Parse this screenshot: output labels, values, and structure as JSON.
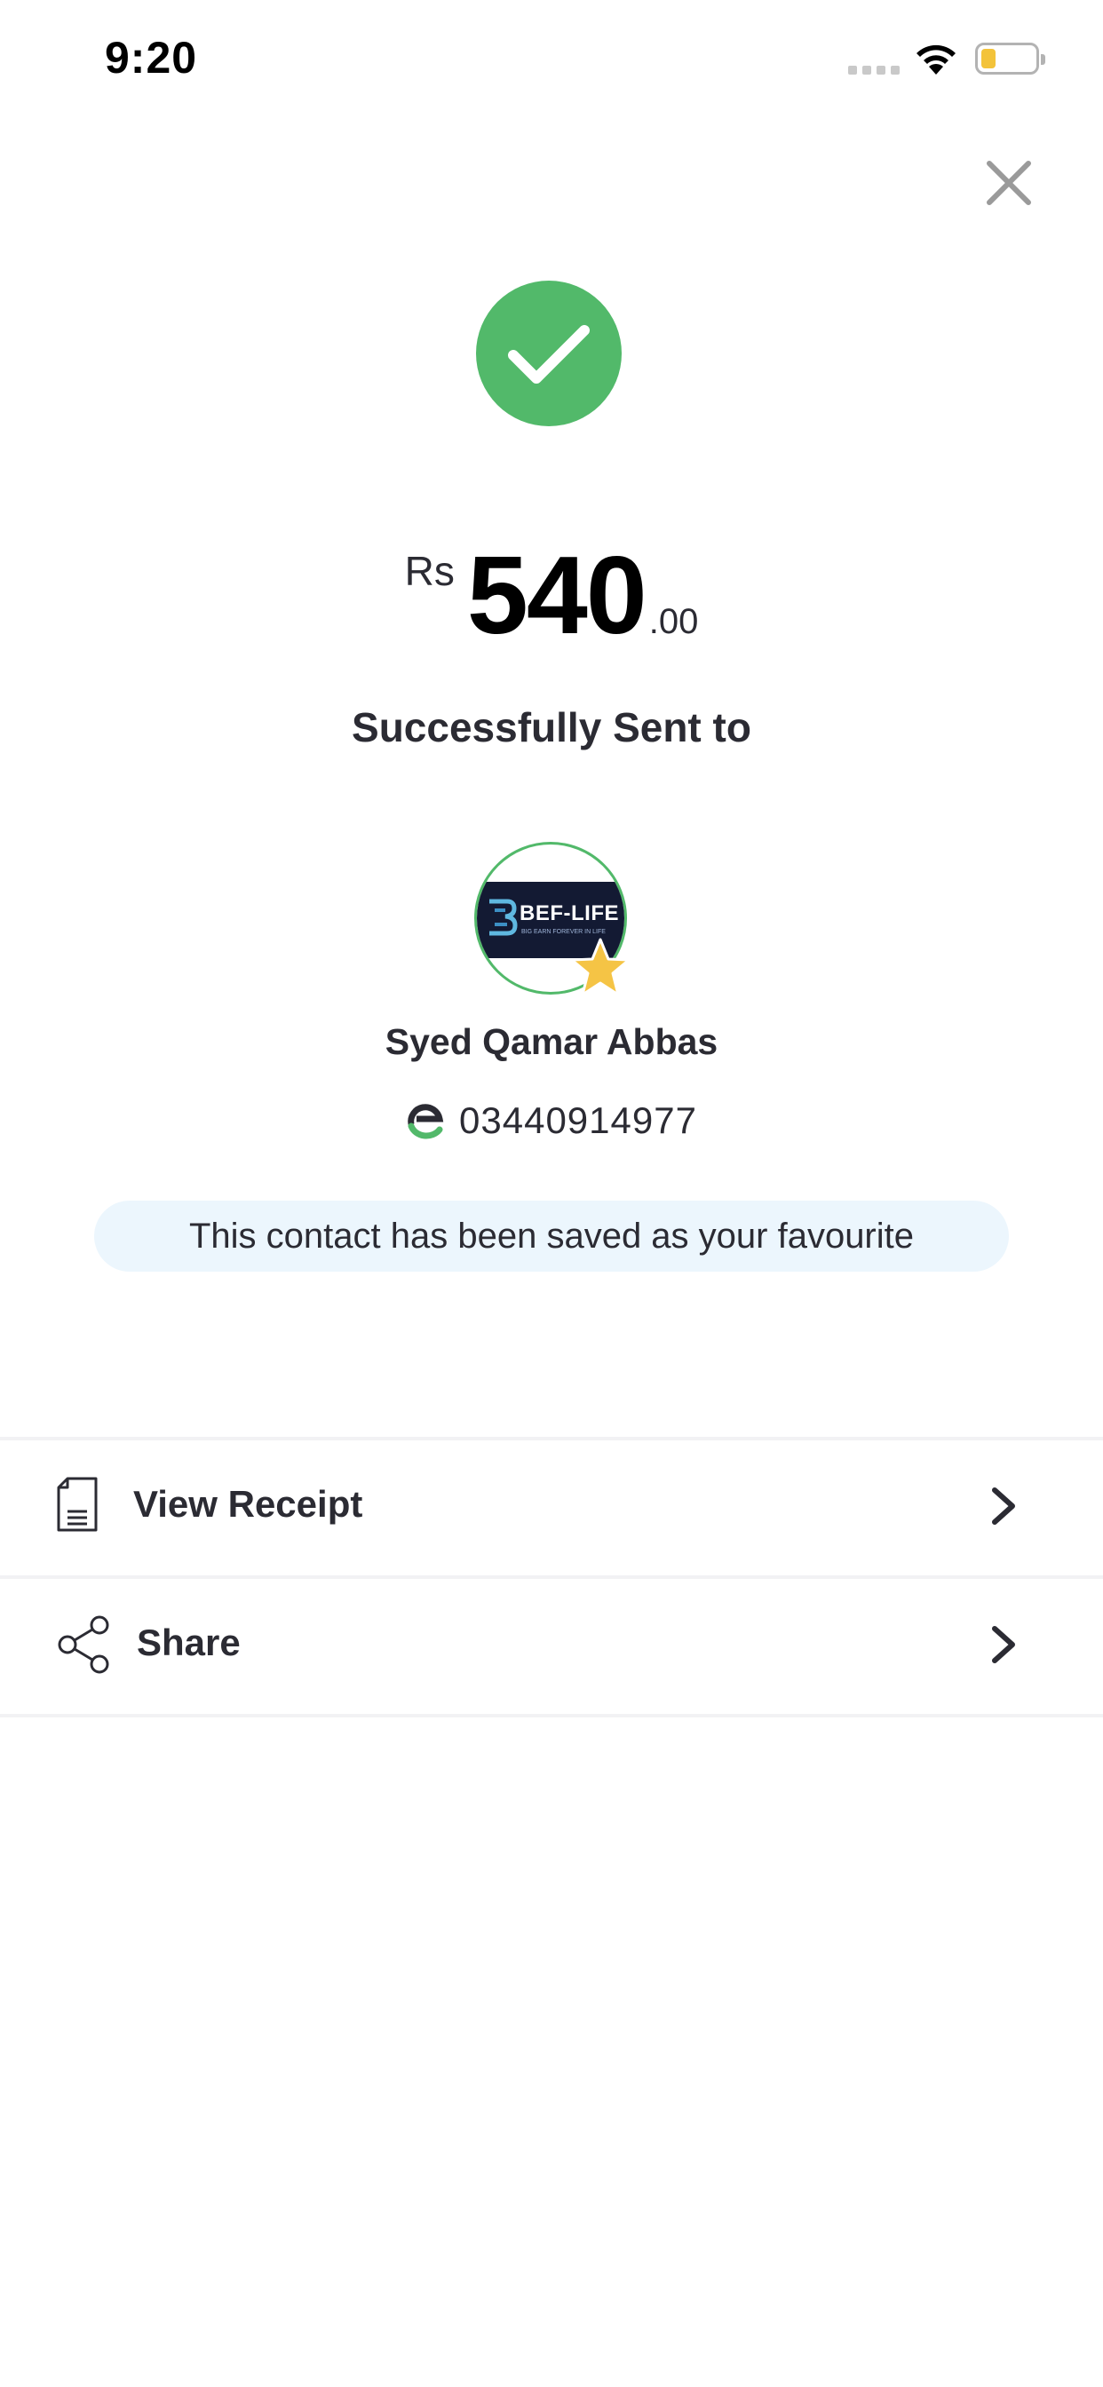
{
  "status_bar": {
    "time": "9:20"
  },
  "payment": {
    "currency": "Rs",
    "amount_whole": "540",
    "amount_decimal": ".00",
    "status_text": "Successfully Sent to"
  },
  "recipient": {
    "avatar_logo_text": "BEF-LIFE",
    "avatar_logo_tagline": "BIG EARN FOREVER IN LIFE",
    "name": "Syed Qamar Abbas",
    "phone": "03440914977"
  },
  "favourite_notice": "This contact has been saved as your favourite",
  "actions": [
    {
      "label": "View Receipt",
      "icon": "receipt-icon"
    },
    {
      "label": "Share",
      "icon": "share-icon"
    }
  ],
  "colors": {
    "success_green": "#52b96a",
    "notice_bg": "#ecf6fd",
    "star_yellow": "#f5c445",
    "text_dark": "#2b2b33"
  }
}
